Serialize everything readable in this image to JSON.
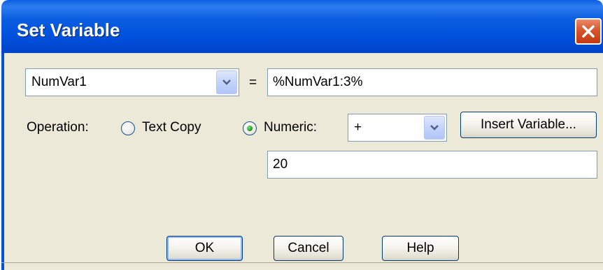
{
  "window": {
    "title": "Set Variable"
  },
  "variable_select": {
    "selected": "NumVar1"
  },
  "equals_sign": "=",
  "expression_input": {
    "value": "%NumVar1:3%"
  },
  "operation": {
    "label": "Operation:",
    "options": [
      {
        "label": "Text Copy",
        "selected": false
      },
      {
        "label": "Numeric:",
        "selected": true
      }
    ]
  },
  "operator_select": {
    "selected": "+"
  },
  "insert_variable_label": "Insert Variable...",
  "operand_input": {
    "value": "20"
  },
  "buttons": {
    "ok": "OK",
    "cancel": "Cancel",
    "help": "Help"
  },
  "icons": {
    "close": "close-icon",
    "dropdown": "chevron-down-icon"
  },
  "colors": {
    "titlebar": "#0050dc",
    "client_bg": "#ece9d8",
    "close_button": "#d8542c",
    "radio_selected": "#21a121"
  }
}
